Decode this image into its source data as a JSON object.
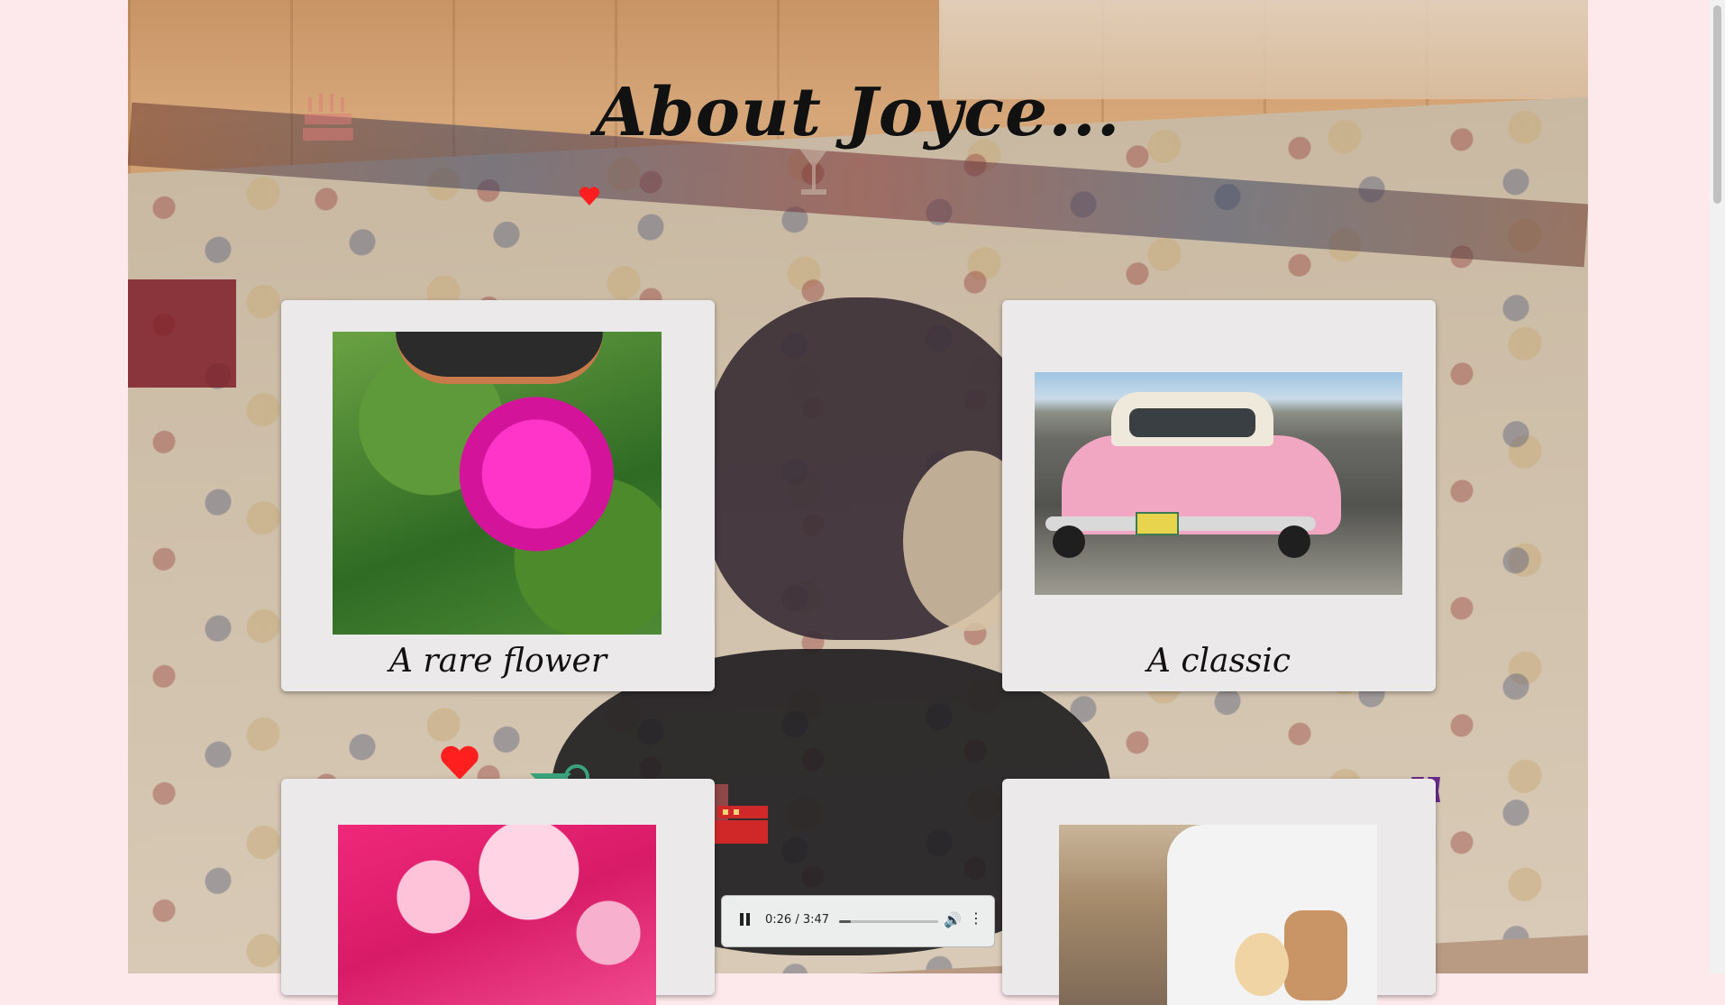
{
  "page": {
    "title": "About Joyce...",
    "background_color": "#fde9ec"
  },
  "cards": [
    {
      "caption": "A rare flower",
      "photo": "pink verbena flower among green leaves"
    },
    {
      "caption": "A classic",
      "photo": "pink classic car on a street"
    },
    {
      "caption": "",
      "photo": "pink sky with clouds"
    },
    {
      "caption": "",
      "photo": "woman seated in a white car"
    }
  ],
  "audio_player": {
    "current_time": "0:26",
    "duration": "3:47",
    "progress": 0.115,
    "state": "playing"
  },
  "decorations": [
    "birthday-cake-icon",
    "heart-icon",
    "cocktail-glass-icon",
    "gift-icon",
    "heart-icon",
    "cocktail-glass-icon",
    "birthday-cake-icon",
    "cheers-glasses-icon"
  ],
  "colors": {
    "heart": "#ff1f1f",
    "gift": "#8e5ad0",
    "cocktail": "#3aa37c",
    "cake": "#d33a3a",
    "cheers": "#6a2a8c",
    "card_bg": "#ebe9e9"
  }
}
